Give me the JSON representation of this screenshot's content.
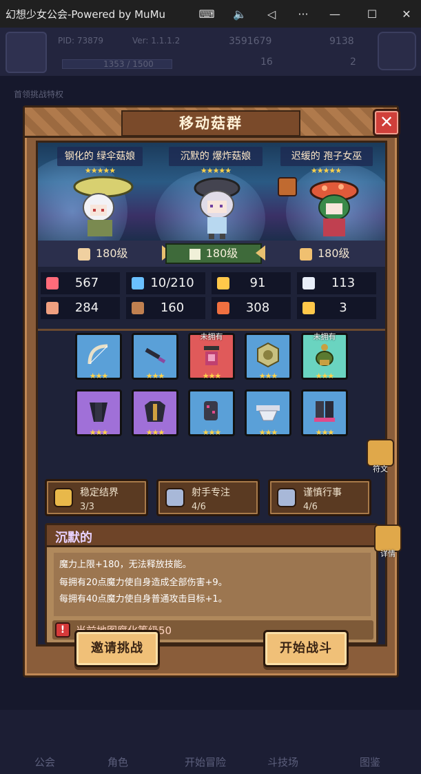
{
  "window": {
    "title": "幻想少女公会-Powered by MuMu",
    "controls": [
      "keyboard-icon",
      "volume-icon",
      "back-icon",
      "more-icon",
      "minimize-icon",
      "maximize-icon",
      "close-icon"
    ]
  },
  "background": {
    "pid": "PID: 73879",
    "version": "Ver: 1.1.1.2",
    "gold": "3591679",
    "gems": "9138",
    "progress": "1353 / 1500",
    "count_a": "16",
    "count_b": "2",
    "side_label": "首领挑战特权",
    "nav": [
      "公会",
      "角色",
      "开始冒险",
      "斗技场",
      "图鉴"
    ]
  },
  "modal": {
    "title": "移动菇群",
    "party": [
      {
        "name": "钢化的 绿伞菇娘",
        "stars": "★★★★★",
        "level": "180级",
        "icon": "shield-badge-icon"
      },
      {
        "name": "沉默的 爆炸菇娘",
        "stars": "★★★★★",
        "level": "180级",
        "icon": "boots-badge-icon"
      },
      {
        "name": "迟缓的 孢子女巫",
        "stars": "★★★★★",
        "level": "180级",
        "icon": "wand-badge-icon"
      }
    ],
    "stats": [
      {
        "icon": "heart-icon",
        "value": "567",
        "color": "#ff6b7a"
      },
      {
        "icon": "mana-drop-icon",
        "value": "10/210",
        "color": "#6ac0ff"
      },
      {
        "icon": "shield-icon",
        "value": "91",
        "color": "#ffc84a"
      },
      {
        "icon": "wing-icon",
        "value": "113",
        "color": "#e8eef8"
      },
      {
        "icon": "fist-icon",
        "value": "284",
        "color": "#f0a080"
      },
      {
        "icon": "book-icon",
        "value": "160",
        "color": "#c08050"
      },
      {
        "icon": "scroll-icon",
        "value": "308",
        "color": "#f07040"
      },
      {
        "icon": "horseshoe-icon",
        "value": "3",
        "color": "#ffc84a"
      }
    ],
    "equipment": [
      {
        "name": "bow-icon",
        "stars": "★★★",
        "tag": "",
        "bg": "#5aa0d8"
      },
      {
        "name": "dagger-icon",
        "stars": "★★★",
        "tag": "",
        "bg": "#5aa0d8"
      },
      {
        "name": "necklace-icon",
        "stars": "★★★",
        "tag": "未拥有",
        "bg": "#e05a5a"
      },
      {
        "name": "coin-amulet-icon",
        "stars": "★★★",
        "tag": "",
        "bg": "#5aa0d8"
      },
      {
        "name": "pendant-icon",
        "stars": "★★★",
        "tag": "未拥有",
        "bg": "#6ad4c0"
      },
      {
        "name": "hat-icon",
        "stars": "★★★",
        "tag": "",
        "bg": "#a070d8"
      },
      {
        "name": "coat-icon",
        "stars": "★★★",
        "tag": "",
        "bg": "#a070d8"
      },
      {
        "name": "gauntlet-icon",
        "stars": "★★★",
        "tag": "",
        "bg": "#5aa0d8"
      },
      {
        "name": "belt-icon",
        "stars": "★★★",
        "tag": "",
        "bg": "#5aa0d8"
      },
      {
        "name": "boots-icon",
        "stars": "★★★",
        "tag": "",
        "bg": "#5aa0d8"
      }
    ],
    "rune_label": "符文",
    "sets": [
      {
        "name": "稳定结界",
        "count": "3/3",
        "color": "#e8b84a"
      },
      {
        "name": "射手专注",
        "count": "4/6",
        "color": "#a8b8d8"
      },
      {
        "name": "谨慎行事",
        "count": "4/6",
        "color": "#a8b8d8"
      }
    ],
    "skill": {
      "name": "沉默的",
      "lines": [
        "魔力上限+180，无法释放技能。",
        "每拥有20点魔力使自身造成全部伤害+9。",
        "每拥有40点魔力使自身普通攻击目标+1。"
      ],
      "warning": "当前地图腐化等级50",
      "detail_label": "详情"
    },
    "buttons": {
      "invite": "邀请挑战",
      "start": "开始战斗"
    }
  }
}
